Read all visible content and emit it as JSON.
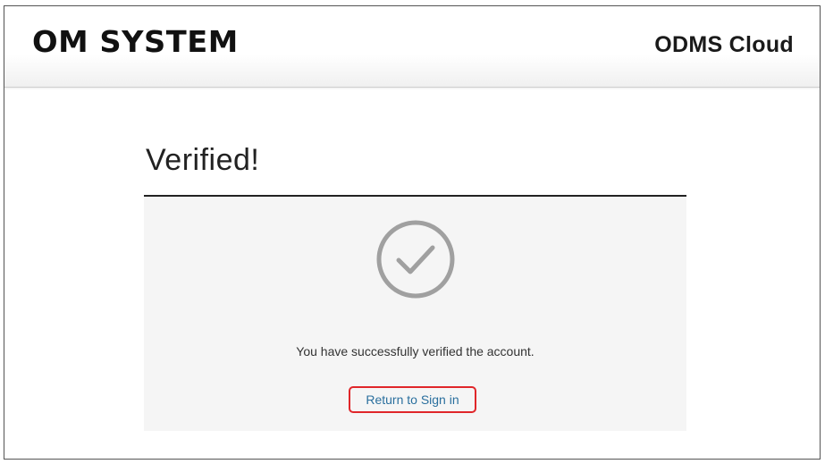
{
  "header": {
    "logo_text": "OM SYSTEM",
    "product_name": "ODMS Cloud"
  },
  "main": {
    "title": "Verified!",
    "status_icon": "check-circle-icon",
    "message": "You have successfully verified the account.",
    "return_link_label": "Return to Sign in"
  },
  "colors": {
    "icon_gray": "#a0a0a0",
    "link_blue": "#2a6f9e",
    "highlight_red": "#e0262a",
    "panel_bg": "#f5f5f5"
  }
}
